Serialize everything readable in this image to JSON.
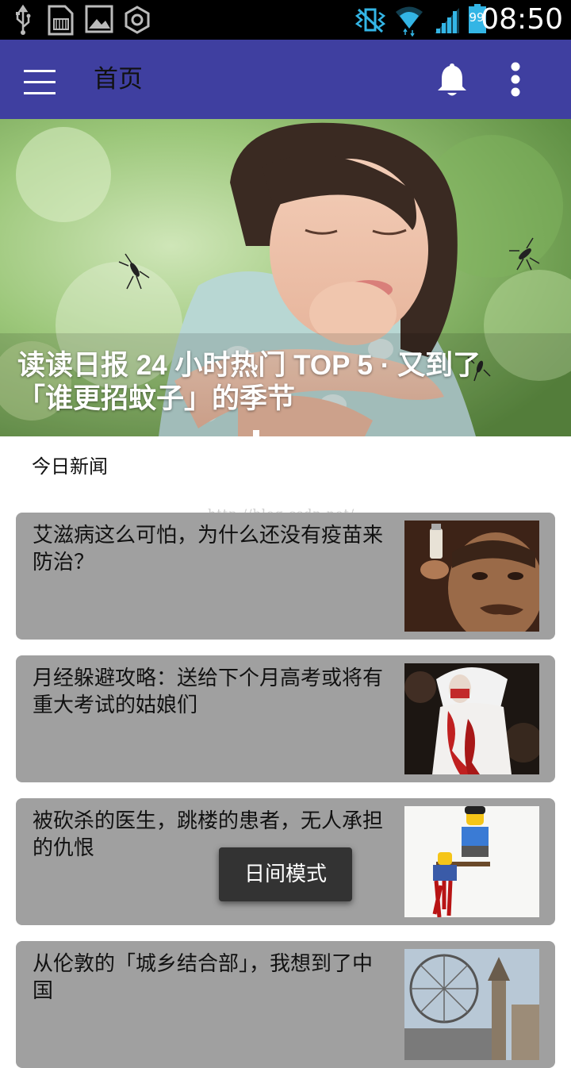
{
  "status_bar": {
    "time": "08:50",
    "battery_level": "99",
    "icons": [
      "usb-icon",
      "sd-card-icon",
      "image-icon",
      "settings-hex-icon",
      "vibrate-icon",
      "wifi-icon",
      "signal-icon",
      "battery-icon"
    ]
  },
  "toolbar": {
    "title": "首页",
    "icons": [
      "menu-icon",
      "bell-icon",
      "more-vert-icon"
    ],
    "background": "#3f3fa0"
  },
  "banner": {
    "caption": "读读日报 24 小时热门 TOP 5 · 又到了「谁更招蚊子」的季节"
  },
  "section": {
    "title": "今日新闻"
  },
  "watermark": "http://blog.csdn.net/",
  "news": [
    {
      "title": "艾滋病这么可怕，为什么还没有疫苗来防治？"
    },
    {
      "title": "月经躲避攻略：送给下个月高考或将有重大考试的姑娘们"
    },
    {
      "title": "被砍杀的医生，跳楼的患者，无人承担的仇恨"
    },
    {
      "title": "从伦敦的「城乡结合部」，我想到了中国"
    }
  ],
  "toast": {
    "text": "日间模式"
  },
  "colors": {
    "card_background": "#a0a0a0",
    "toolbar": "#3f3fa0",
    "status_bar": "#000000"
  }
}
